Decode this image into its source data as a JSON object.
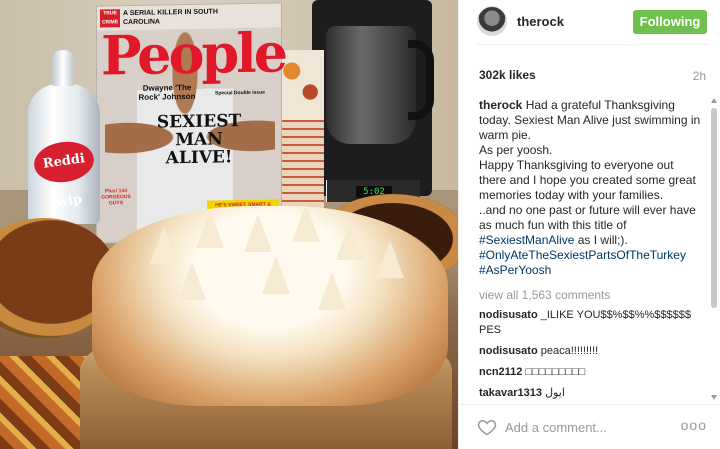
{
  "post": {
    "username": "therock",
    "follow_label": "Following",
    "likes": "302k likes",
    "time_ago": "2h",
    "caption_user": "therock",
    "caption_lines": [
      "Had a grateful Thanksgiving today. Sexiest Man Alive just swimming in warm pie.",
      "As per yoosh.",
      "Happy Thanksgiving to everyone out there and I hope you created some great memories today with your families.",
      "..and no one past or future will ever have as much fun with this title of"
    ],
    "caption_hashtag_1": "#SexiestManAlive",
    "caption_tail": "as I will;).",
    "caption_hashtag_2": "#OnlyAteTheSexiestPartsOfTheTurkey",
    "caption_hashtag_3": "#AsPerYoosh",
    "view_all": "view all 1,563 comments",
    "comments": [
      {
        "user": "nodisusato",
        "text": "_ILIKE YOU$$%$$%%$$$$$$ PES"
      },
      {
        "user": "nodisusato",
        "text": "peaca!!!!!!!!!"
      },
      {
        "user": "ncn2112",
        "text": "□□□□□□□□□"
      },
      {
        "user": "takavar1313",
        "text": "ایول"
      }
    ],
    "add_comment_placeholder": "Add a comment...",
    "more_label": "ooo"
  },
  "photo": {
    "magazine": {
      "top_tag": "TRUE CRIME",
      "top_headline": "A SERIAL KILLER IN SOUTH CAROLINA",
      "logo": "People",
      "cover_name": "Dwayne 'The Rock' Johnson",
      "cover_headline": "SEXIEST MAN ALIVE!",
      "issue": "Special Double Issue",
      "count_label": "Plus! 144 GORGEOUS GUYS",
      "tagline": "HE'S SWEET, SMART & SCULPTED!"
    },
    "can_label": "Reddi wip",
    "coffee_clock": "5:02"
  },
  "colors": {
    "follow_button": "#70c050",
    "hashtag": "#003569",
    "muted": "#999999"
  }
}
